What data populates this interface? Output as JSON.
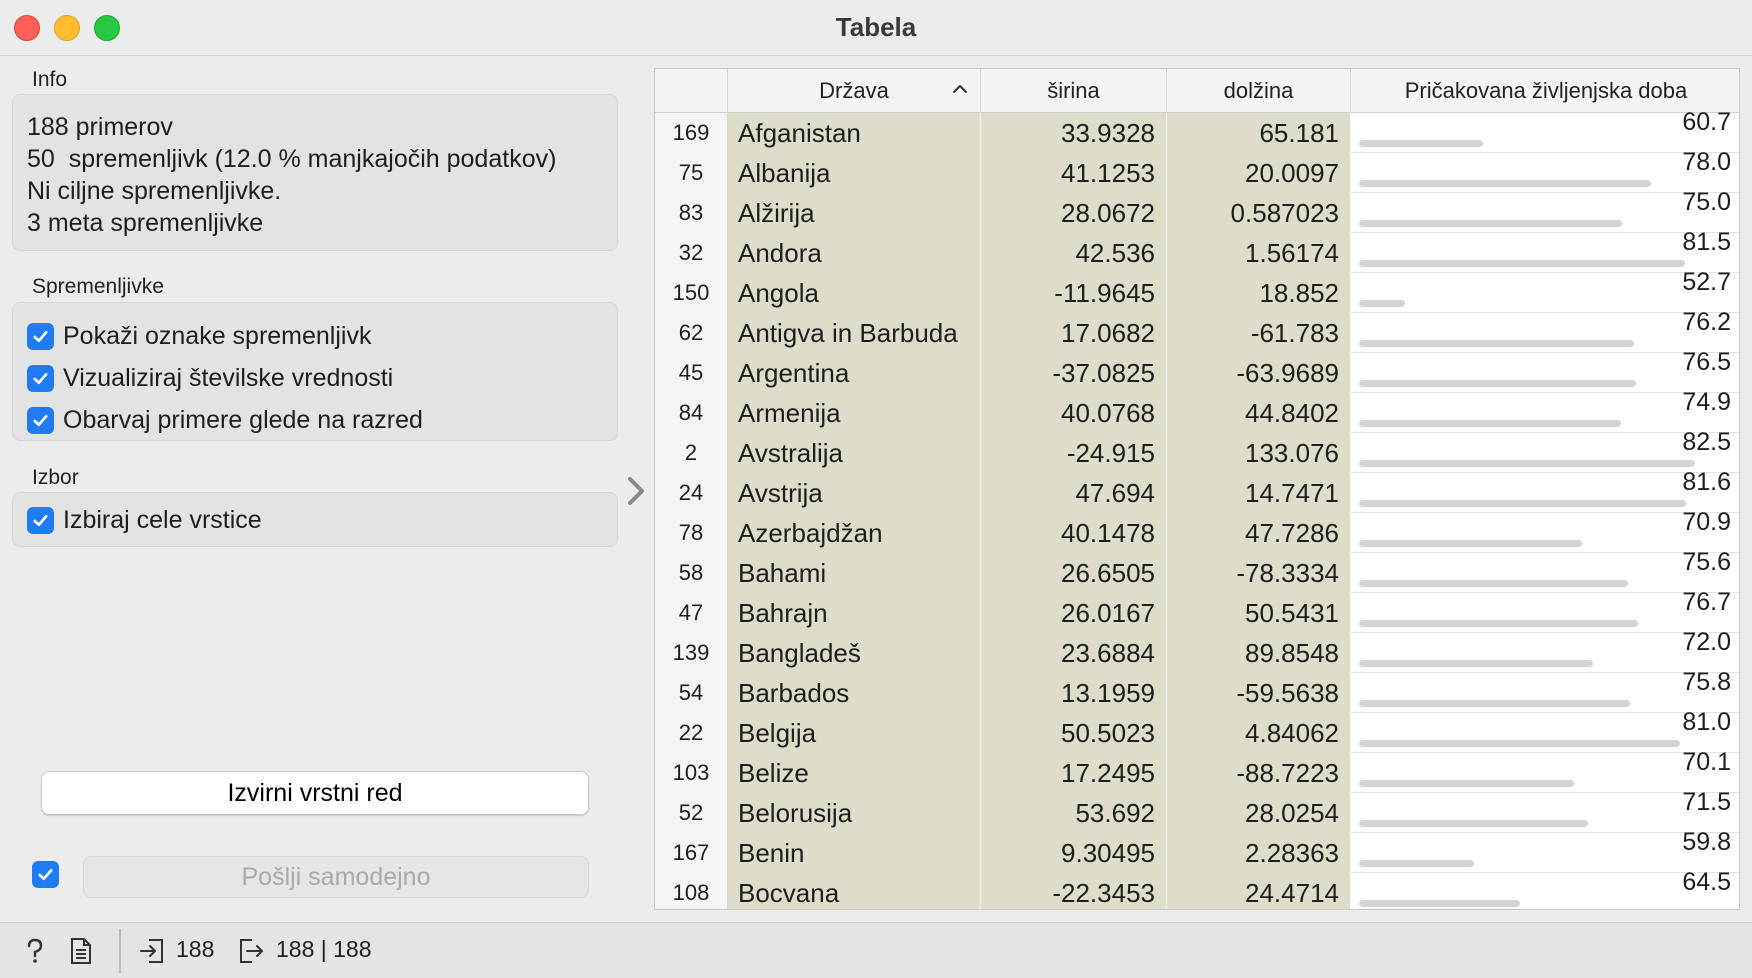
{
  "window": {
    "title": "Tabela"
  },
  "info": {
    "label": "Info",
    "lines": [
      "188 primerov",
      "50  spremenljivk (12.0 % manjkajočih podatkov)",
      "Ni ciljne spremenljivke.",
      "3 meta spremenljivke"
    ]
  },
  "variables": {
    "label": "Spremenljivke",
    "options": [
      {
        "label": "Pokaži oznake spremenljivk",
        "checked": true
      },
      {
        "label": "Vizualiziraj številske vrednosti",
        "checked": true
      },
      {
        "label": "Obarvaj primere glede na razred",
        "checked": true
      }
    ]
  },
  "selection": {
    "label": "Izbor",
    "options": [
      {
        "label": "Izbiraj cele vrstice",
        "checked": true
      }
    ]
  },
  "buttons": {
    "restore_order": "Izvirni vrstni red",
    "send_auto": "Pošlji samodejno",
    "send_auto_checked": true
  },
  "table": {
    "columns": [
      "",
      "Država",
      "širina",
      "dolžina",
      "Pričakovana življenjska doba"
    ],
    "sorted_by": "Država",
    "sort_direction": "ascending",
    "rows": [
      {
        "idx": "169",
        "country": "Afganistan",
        "lat": "33.9328",
        "lon": "65.181",
        "life": "60.7"
      },
      {
        "idx": "75",
        "country": "Albanija",
        "lat": "41.1253",
        "lon": "20.0097",
        "life": "78.0"
      },
      {
        "idx": "83",
        "country": "Alžirija",
        "lat": "28.0672",
        "lon": "0.587023",
        "life": "75.0"
      },
      {
        "idx": "32",
        "country": "Andora",
        "lat": "42.536",
        "lon": "1.56174",
        "life": "81.5"
      },
      {
        "idx": "150",
        "country": "Angola",
        "lat": "-11.9645",
        "lon": "18.852",
        "life": "52.7"
      },
      {
        "idx": "62",
        "country": "Antigva in Barbuda",
        "lat": "17.0682",
        "lon": "-61.783",
        "life": "76.2"
      },
      {
        "idx": "45",
        "country": "Argentina",
        "lat": "-37.0825",
        "lon": "-63.9689",
        "life": "76.5"
      },
      {
        "idx": "84",
        "country": "Armenija",
        "lat": "40.0768",
        "lon": "44.8402",
        "life": "74.9"
      },
      {
        "idx": "2",
        "country": "Avstralija",
        "lat": "-24.915",
        "lon": "133.076",
        "life": "82.5"
      },
      {
        "idx": "24",
        "country": "Avstrija",
        "lat": "47.694",
        "lon": "14.7471",
        "life": "81.6"
      },
      {
        "idx": "78",
        "country": "Azerbajdžan",
        "lat": "40.1478",
        "lon": "47.7286",
        "life": "70.9"
      },
      {
        "idx": "58",
        "country": "Bahami",
        "lat": "26.6505",
        "lon": "-78.3334",
        "life": "75.6"
      },
      {
        "idx": "47",
        "country": "Bahrajn",
        "lat": "26.0167",
        "lon": "50.5431",
        "life": "76.7"
      },
      {
        "idx": "139",
        "country": "Bangladeš",
        "lat": "23.6884",
        "lon": "89.8548",
        "life": "72.0"
      },
      {
        "idx": "54",
        "country": "Barbados",
        "lat": "13.1959",
        "lon": "-59.5638",
        "life": "75.8"
      },
      {
        "idx": "22",
        "country": "Belgija",
        "lat": "50.5023",
        "lon": "4.84062",
        "life": "81.0"
      },
      {
        "idx": "103",
        "country": "Belize",
        "lat": "17.2495",
        "lon": "-88.7223",
        "life": "70.1"
      },
      {
        "idx": "52",
        "country": "Belorusija",
        "lat": "53.692",
        "lon": "28.0254",
        "life": "71.5"
      },
      {
        "idx": "167",
        "country": "Benin",
        "lat": "9.30495",
        "lon": "2.28363",
        "life": "59.8"
      },
      {
        "idx": "108",
        "country": "Bocvana",
        "lat": "-22.3453",
        "lon": "24.4714",
        "life": "64.5"
      }
    ]
  },
  "status": {
    "input_count": "188",
    "output_count": "188 | 188"
  },
  "icons": {
    "help": "help-icon",
    "report": "report-icon",
    "input": "input-data-icon",
    "output": "output-data-icon"
  },
  "colors": {
    "checkbox": "#1f7cf5",
    "cell_highlight": "#deddc9",
    "value_bar": "#d4d4d4"
  }
}
